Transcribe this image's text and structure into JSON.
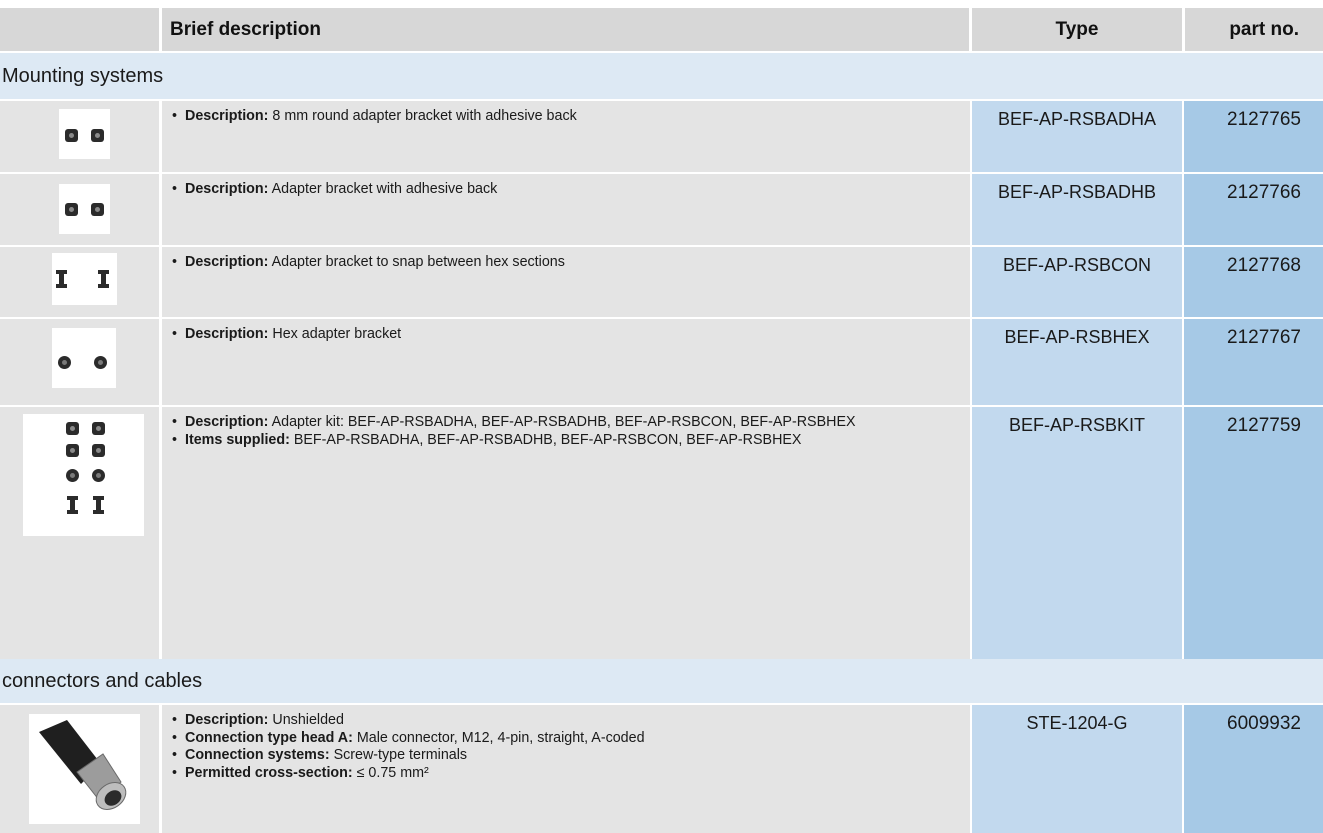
{
  "header": {
    "brief_description": "Brief description",
    "type": "Type",
    "part_no": "part no."
  },
  "sections": {
    "mounting": "Mounting systems",
    "connectors": "connectors and cables"
  },
  "rows": [
    {
      "image_icon": "round-adapter-bracket-icon",
      "bullets": [
        {
          "label": "Description:",
          "text": " 8 mm round adapter bracket with adhesive back"
        }
      ],
      "type": "BEF-AP-RSBADHA",
      "part_no": "2127765"
    },
    {
      "image_icon": "adapter-bracket-icon",
      "bullets": [
        {
          "label": "Description:",
          "text": " Adapter bracket with adhesive back"
        }
      ],
      "type": "BEF-AP-RSBADHB",
      "part_no": "2127766"
    },
    {
      "image_icon": "snap-bracket-icon",
      "bullets": [
        {
          "label": "Description:",
          "text": " Adapter bracket to snap between hex sections"
        }
      ],
      "type": "BEF-AP-RSBCON",
      "part_no": "2127768"
    },
    {
      "image_icon": "hex-bracket-icon",
      "bullets": [
        {
          "label": "Description:",
          "text": " Hex adapter bracket"
        }
      ],
      "type": "BEF-AP-RSBHEX",
      "part_no": "2127767"
    },
    {
      "image_icon": "adapter-kit-icon",
      "bullets": [
        {
          "label": "Description:",
          "text": " Adapter kit: BEF-AP-RSBADHA, BEF-AP-RSBADHB, BEF-AP-RSBCON, BEF-AP-RSBHEX"
        },
        {
          "label": "Items supplied:",
          "text": " BEF-AP-RSBADHA, BEF-AP-RSBADHB, BEF-AP-RSBCON, BEF-AP-RSBHEX"
        }
      ],
      "type": "BEF-AP-RSBKIT",
      "part_no": "2127759"
    },
    {
      "image_icon": "m12-connector-icon",
      "bullets": [
        {
          "label": "Description:",
          "text": " Unshielded"
        },
        {
          "label": "Connection type head A:",
          "text": " Male connector, M12, 4-pin, straight, A-coded"
        },
        {
          "label": "Connection systems:",
          "text": " Screw-type terminals"
        },
        {
          "label": "Permitted cross-section:",
          "text": " ≤ 0.75 mm²"
        }
      ],
      "type": "STE-1204-G",
      "part_no": "6009932"
    }
  ],
  "colors": {
    "header_bg": "#d7d7d7",
    "section_bg": "#dde9f4",
    "cell_bg": "#e4e4e4",
    "type_bg": "#c2d9ee",
    "part_bg": "#a6c9e6"
  }
}
